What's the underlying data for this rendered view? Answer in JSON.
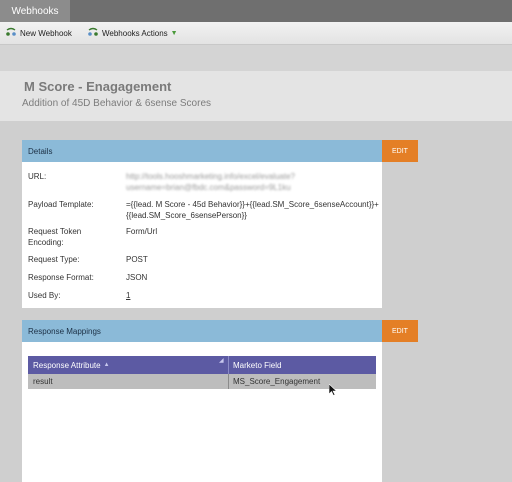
{
  "tabs": [
    {
      "label": "Webhooks"
    }
  ],
  "toolbar": {
    "new_label": "New Webhook",
    "actions_label": "Webhooks Actions",
    "actions_arrow": "▼"
  },
  "page": {
    "title": "M Score - Enagagement",
    "subtitle": "Addition of 45D Behavior & 6sense Scores"
  },
  "details": {
    "header": "Details",
    "edit_label": "EDIT",
    "fields": [
      {
        "label": "URL:",
        "value": "http://tools.hooshmarketing.info/excel/evaluate?username=brian@fbdc.com&password=9L1ku"
      },
      {
        "label": "Payload Template:",
        "value": "={{lead. M Score - 45d Behavior}}+{{lead.SM_Score_6senseAccount}}+{{lead.SM_Score_6sensePerson}}"
      },
      {
        "label": "Request Token Encoding:",
        "value": "Form/Url"
      },
      {
        "label": "Request Type:",
        "value": "POST"
      },
      {
        "label": "Response Format:",
        "value": "JSON"
      },
      {
        "label": "Used By:",
        "value": "1"
      }
    ]
  },
  "mappings": {
    "header": "Response Mappings",
    "edit_label": "EDIT",
    "columns": [
      "Response Attribute",
      "Marketo Field"
    ],
    "rows": [
      [
        "result",
        "MS_Score_Engagement"
      ]
    ]
  },
  "colors": {
    "panel_header": "#8bbad8",
    "edit_button": "#e47f26",
    "grid_header": "#5c5aa3"
  }
}
